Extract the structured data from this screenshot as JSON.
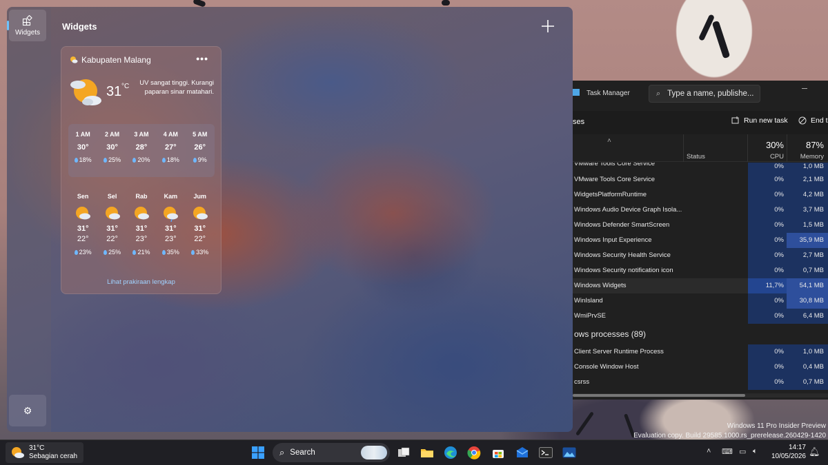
{
  "widgets": {
    "rail_label": "Widgets",
    "title": "Widgets",
    "weather": {
      "location": "Kabupaten Malang",
      "temp": "31",
      "unit": "°C",
      "uv_note": "UV sangat tinggi. Kurangi paparan sinar matahari.",
      "hourly": [
        {
          "time": "1 AM",
          "temp": "30°",
          "precip": "18%"
        },
        {
          "time": "2 AM",
          "temp": "30°",
          "precip": "25%"
        },
        {
          "time": "3 AM",
          "temp": "28°",
          "precip": "20%"
        },
        {
          "time": "4 AM",
          "temp": "27°",
          "precip": "18%"
        },
        {
          "time": "5 AM",
          "temp": "26°",
          "precip": "9%"
        }
      ],
      "daily": [
        {
          "day": "Sen",
          "hi": "31°",
          "lo": "22°",
          "precip": "23%"
        },
        {
          "day": "Sel",
          "hi": "31°",
          "lo": "22°",
          "precip": "25%"
        },
        {
          "day": "Rab",
          "hi": "31°",
          "lo": "23°",
          "precip": "21%"
        },
        {
          "day": "Kam",
          "hi": "31°",
          "lo": "23°",
          "precip": "35%"
        },
        {
          "day": "Jum",
          "hi": "31°",
          "lo": "22°",
          "precip": "33%"
        }
      ],
      "full_forecast_link": "Lihat prakiraan lengkap"
    }
  },
  "task_manager": {
    "title": "Task Manager",
    "search_placeholder": "Type a name, publishe...",
    "section_label": "ses",
    "run_new_task": "Run new task",
    "end_task": "End ta",
    "columns": {
      "status": "Status",
      "cpu_pct": "30%",
      "cpu": "CPU",
      "mem_pct": "87%",
      "mem": "Memory"
    },
    "rows": [
      {
        "name": "VMware Tools Core Service",
        "cpu": "0%",
        "mem": "1,0 MB",
        "cut": true
      },
      {
        "name": "VMware Tools Core Service",
        "cpu": "0%",
        "mem": "2,1 MB"
      },
      {
        "name": "WidgetsPlatformRuntime",
        "cpu": "0%",
        "mem": "4,2 MB"
      },
      {
        "name": "Windows Audio Device Graph Isola...",
        "cpu": "0%",
        "mem": "3,7 MB"
      },
      {
        "name": "Windows Defender SmartScreen",
        "cpu": "0%",
        "mem": "1,5 MB"
      },
      {
        "name": "Windows Input Experience",
        "cpu": "0%",
        "mem": "35,9 MB",
        "hot": true
      },
      {
        "name": "Windows Security Health Service",
        "cpu": "0%",
        "mem": "2,7 MB"
      },
      {
        "name": "Windows Security notification icon",
        "cpu": "0%",
        "mem": "0,7 MB"
      },
      {
        "name": "Windows Widgets",
        "cpu": "11,7%",
        "mem": "54,1 MB",
        "sel": true,
        "hot": true
      },
      {
        "name": "WinIsland",
        "cpu": "0%",
        "mem": "30,8 MB",
        "hot": true
      },
      {
        "name": "WmiPrvSE",
        "cpu": "0%",
        "mem": "6,4 MB"
      },
      {
        "name": "ows processes (89)",
        "group": true
      },
      {
        "name": "Client Server Runtime Process",
        "cpu": "0%",
        "mem": "1,0 MB"
      },
      {
        "name": "Console Window Host",
        "cpu": "0%",
        "mem": "0,4 MB"
      },
      {
        "name": "csrss",
        "cpu": "0%",
        "mem": "0,7 MB"
      }
    ]
  },
  "watermark": {
    "line1": "Windows 11 Pro Insider Preview",
    "line2": "Evaluation copy. Build 29585.1000.rs_prerelease.260429-1420"
  },
  "taskbar": {
    "weather_temp": "31°C",
    "weather_desc": "Sebagian cerah",
    "search_label": "Search",
    "time": "14:17",
    "date": "10/05/2026"
  },
  "colors": {
    "accent": "#6cc3ff",
    "cpu_cell": "#1c3260",
    "mem_hot": "#2e4f9c",
    "link": "#9fd2ff"
  }
}
